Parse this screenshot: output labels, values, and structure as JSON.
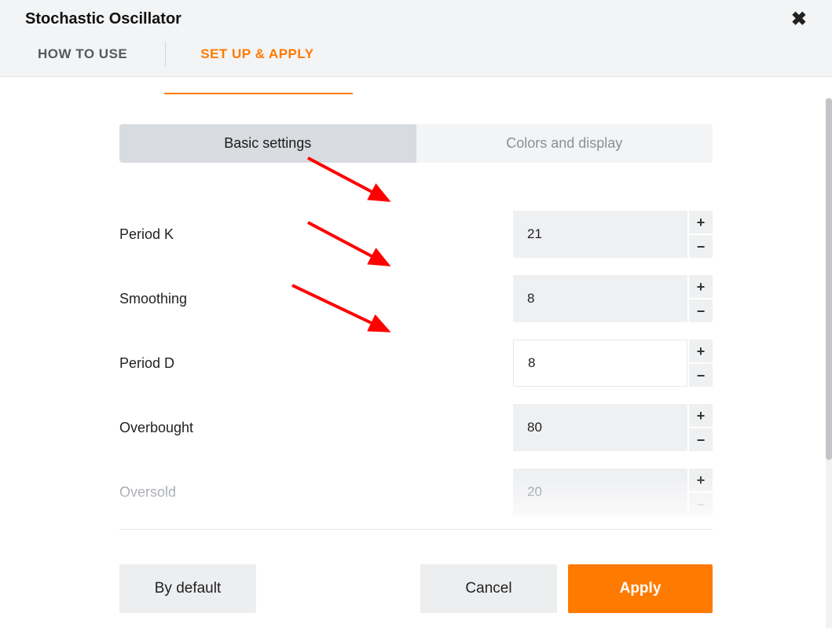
{
  "title": "Stochastic Oscillator",
  "tabs": {
    "how_to_use": "HOW TO USE",
    "setup_apply": "SET UP & APPLY"
  },
  "inner_tabs": {
    "basic": "Basic settings",
    "colors": "Colors and display"
  },
  "settings": [
    {
      "label": "Period K",
      "value": "21",
      "input_style": "gray"
    },
    {
      "label": "Smoothing",
      "value": "8",
      "input_style": "gray"
    },
    {
      "label": "Period D",
      "value": "8",
      "input_style": "white"
    },
    {
      "label": "Overbought",
      "value": "80",
      "input_style": "gray"
    },
    {
      "label": "Oversold",
      "value": "20",
      "input_style": "gray",
      "faded": true
    }
  ],
  "buttons": {
    "by_default": "By default",
    "cancel": "Cancel",
    "apply": "Apply"
  },
  "icons": {
    "close": "✖",
    "plus": "+",
    "minus": "−"
  },
  "colors": {
    "accent": "#ff7a00",
    "arrow": "#ff0000"
  }
}
